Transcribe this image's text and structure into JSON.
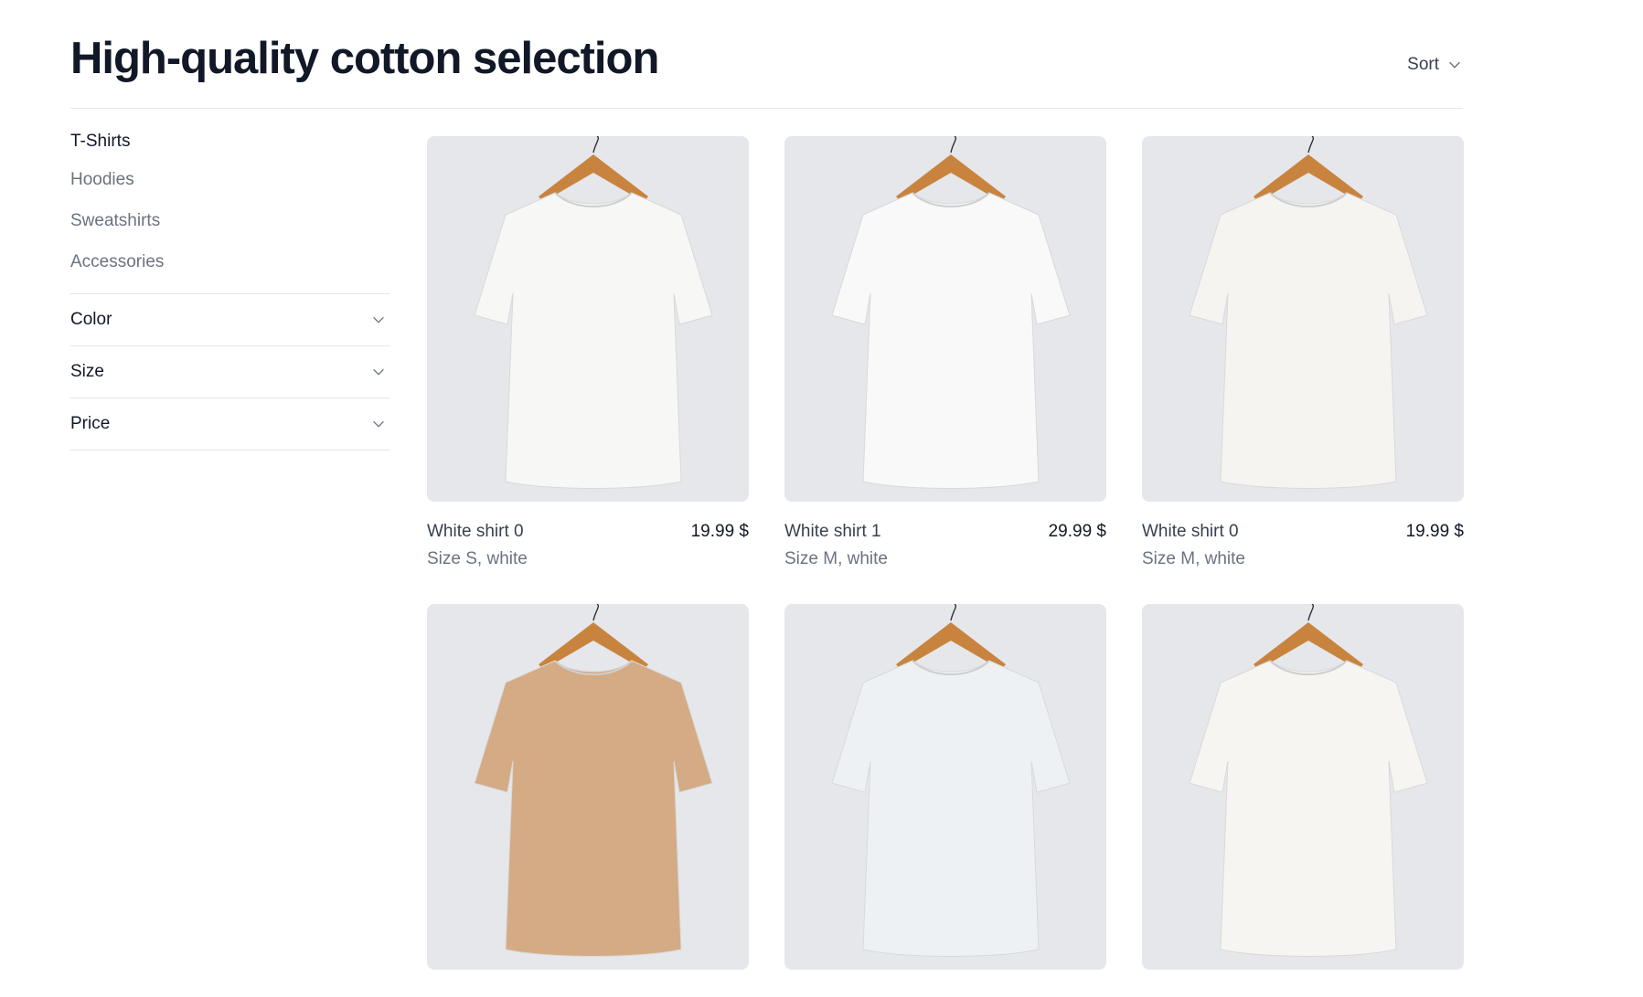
{
  "header": {
    "title": "High-quality cotton selection",
    "sort_label": "Sort"
  },
  "sidebar": {
    "categories": [
      {
        "label": "T-Shirts",
        "active": true
      },
      {
        "label": "Hoodies",
        "active": false
      },
      {
        "label": "Sweatshirts",
        "active": false
      },
      {
        "label": "Accessories",
        "active": false
      }
    ],
    "filters": [
      {
        "label": "Color"
      },
      {
        "label": "Size"
      },
      {
        "label": "Price"
      }
    ]
  },
  "products": [
    {
      "name": "White shirt 0",
      "price": "19.99 $",
      "variant": "Size S, white",
      "shirt_color": "#f7f7f5"
    },
    {
      "name": "White shirt 1",
      "price": "29.99 $",
      "variant": "Size M, white",
      "shirt_color": "#f9f9f9"
    },
    {
      "name": "White shirt 0",
      "price": "19.99 $",
      "variant": "Size M, white",
      "shirt_color": "#f5f4f1"
    },
    {
      "name": "",
      "price": "",
      "variant": "",
      "shirt_color": "#d4ab84"
    },
    {
      "name": "",
      "price": "",
      "variant": "",
      "shirt_color": "#eef1f4"
    },
    {
      "name": "",
      "price": "",
      "variant": "",
      "shirt_color": "#f6f5f2"
    }
  ],
  "colors": {
    "thumb_bg": "#e5e7eb",
    "hanger": "#c8843e",
    "border": "#e5e7eb"
  }
}
